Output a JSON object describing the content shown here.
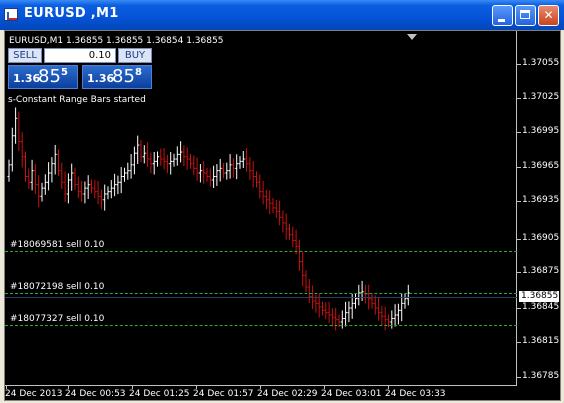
{
  "window": {
    "title": "EURUSD ,M1"
  },
  "chart": {
    "caption": "EURUSD,M1  1.36855 1.36855 1.36854 1.36855",
    "status": "s-Constant Range Bars started",
    "trade_panel": {
      "sell_label": "SELL",
      "buy_label": "BUY",
      "lot": "0.10",
      "bid_small": "1.36",
      "bid_big": "85",
      "bid_sup": "5",
      "ask_small": "1.36",
      "ask_big": "85",
      "ask_sup": "8"
    },
    "orders": [
      {
        "label": "#18069581 sell 0.10",
        "price": 1.36887
      },
      {
        "label": "#18072198 sell 0.10",
        "price": 1.36857
      },
      {
        "label": "#18077327 sell 0.10",
        "price": 1.36838
      }
    ],
    "current_price": "1.36855",
    "price_ticks": [
      "1.37055",
      "1.37025",
      "1.36995",
      "1.36965",
      "1.36935",
      "1.36905",
      "1.36875",
      "1.36845",
      "1.36815",
      "1.36785"
    ],
    "time_ticks": [
      "24 Dec 2013",
      "24 Dec 00:53",
      "24 Dec 01:25",
      "24 Dec 01:57",
      "24 Dec 02:29",
      "24 Dec 03:01",
      "24 Dec 03:33"
    ],
    "colors": {
      "bull": "#ffffff",
      "bear": "#cc1111",
      "grid_line": "#2faa2f"
    }
  },
  "chart_data": {
    "type": "ohlc-bars",
    "symbol": "EURUSD",
    "timeframe": "M1",
    "ylim": [
      1.36775,
      1.3708
    ],
    "price_axis": [
      1.37055,
      1.37025,
      1.36995,
      1.36965,
      1.36935,
      1.36905,
      1.36875,
      1.36845,
      1.36815,
      1.36785
    ],
    "x_labels": [
      "24 Dec 2013",
      "24 Dec 00:53",
      "24 Dec 01:25",
      "24 Dec 01:57",
      "24 Dec 02:29",
      "24 Dec 03:01",
      "24 Dec 03:33"
    ],
    "closes": [
      1.36965,
      1.3699,
      1.37005,
      1.36985,
      1.36972,
      1.36955,
      1.3695,
      1.3696,
      1.36948,
      1.36938,
      1.36945,
      1.3695,
      1.36958,
      1.36966,
      1.36974,
      1.3696,
      1.3695,
      1.3694,
      1.36952,
      1.36958,
      1.36948,
      1.36942,
      1.3694,
      1.36945,
      1.36948,
      1.36945,
      1.36942,
      1.36938,
      1.36935,
      1.3694,
      1.36942,
      1.36945,
      1.36948,
      1.3695,
      1.36955,
      1.36958,
      1.3696,
      1.36965,
      1.36975,
      1.36982,
      1.36972,
      1.36975,
      1.3697,
      1.36966,
      1.36968,
      1.36972,
      1.3697,
      1.36968,
      1.36966,
      1.36968,
      1.3697,
      1.36974,
      1.36976,
      1.36972,
      1.3697,
      1.36966,
      1.36962,
      1.36958,
      1.3696,
      1.36958,
      1.36955,
      1.36952,
      1.36955,
      1.3696,
      1.36962,
      1.36958,
      1.3696,
      1.36965,
      1.36962,
      1.36966,
      1.36968,
      1.3697,
      1.36966,
      1.3696,
      1.36955,
      1.3695,
      1.36942,
      1.36938,
      1.36935,
      1.36932,
      1.36928,
      1.36925,
      1.3692,
      1.36915,
      1.3691,
      1.36905,
      1.369,
      1.36895,
      1.36882,
      1.3687,
      1.3686,
      1.36852,
      1.36848,
      1.36846,
      1.36843,
      1.3684,
      1.36838,
      1.36836,
      1.36834,
      1.36832,
      1.3683,
      1.36833,
      1.36838,
      1.36842,
      1.36846,
      1.3685,
      1.36855,
      1.36856,
      1.36854,
      1.3685,
      1.36846,
      1.36842,
      1.36838,
      1.36835,
      1.36832,
      1.3683,
      1.36833,
      1.36836,
      1.3684,
      1.36846,
      1.3685,
      1.36855
    ]
  }
}
